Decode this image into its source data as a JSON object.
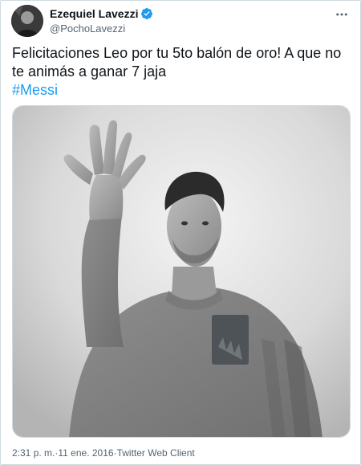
{
  "author": {
    "display_name": "Ezequiel Lavezzi",
    "handle": "@PochoLavezzi",
    "verified_icon": "verified-badge-icon",
    "accent": "#1d9bf0"
  },
  "tweet": {
    "text": "Felicitaciones Leo por tu 5to balón de oro! A que no te animás a ganar 7 jaja",
    "hashtag": "#Messi"
  },
  "meta": {
    "time": "2:31 p. m.",
    "separator1": " · ",
    "date": "11 ene. 2016",
    "separator2": " · ",
    "client": "Twitter Web Client"
  },
  "icons": {
    "more": "more-options-icon"
  }
}
